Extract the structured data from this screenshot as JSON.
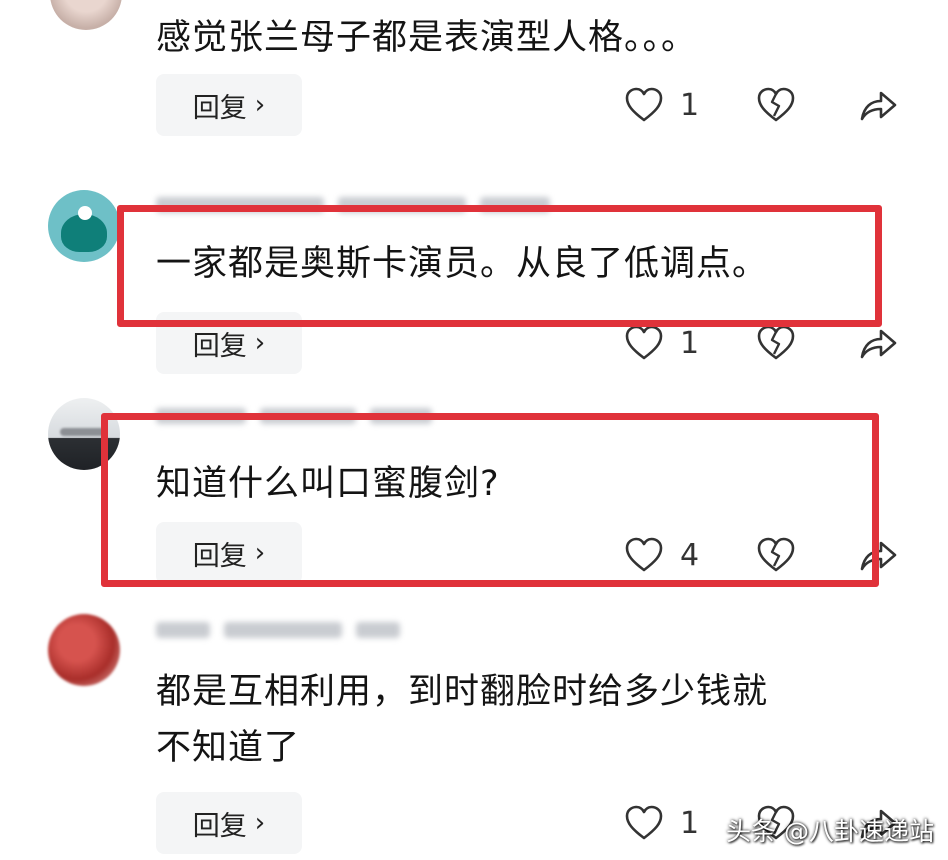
{
  "comments": [
    {
      "text": "感觉张兰母子都是表演型人格。。。",
      "reply_label": "回复",
      "likes": "1"
    },
    {
      "text": "一家都是奥斯卡演员。从良了低调点。",
      "reply_label": "回复",
      "likes": "1"
    },
    {
      "text": "知道什么叫口蜜腹剑?",
      "reply_label": "回复",
      "likes": "4"
    },
    {
      "text_line1": "都是互相利用，到时翻脸时给多少钱就",
      "text_line2": "不知道了",
      "reply_label": "回复",
      "likes": "1"
    }
  ],
  "watermark": "头条 @八卦速递站",
  "colors": {
    "highlight": "#e0323a",
    "reply_bg": "#f4f5f6",
    "icon": "#333333"
  },
  "icons": [
    "heart-outline",
    "broken-heart",
    "share-arrow",
    "chevron-right"
  ]
}
